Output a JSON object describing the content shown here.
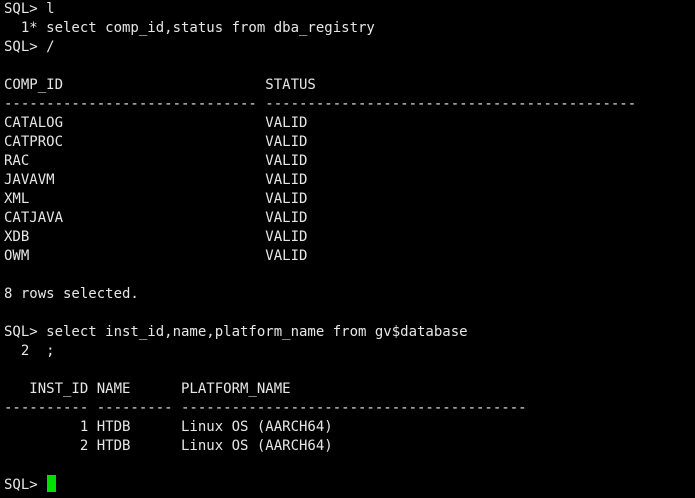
{
  "terminal": {
    "lines": [
      "SQL> l",
      "  1* select comp_id,status from dba_registry",
      "SQL> /",
      "",
      "COMP_ID                        STATUS",
      "------------------------------ --------------------------------------------",
      "CATALOG                        VALID",
      "CATPROC                        VALID",
      "RAC                            VALID",
      "JAVAVM                         VALID",
      "XML                            VALID",
      "CATJAVA                        VALID",
      "XDB                            VALID",
      "OWM                            VALID",
      "",
      "8 rows selected.",
      "",
      "SQL> select inst_id,name,platform_name from gv$database",
      "  2  ;",
      "",
      "   INST_ID NAME      PLATFORM_NAME",
      "---------- --------- -----------------------------------------",
      "         1 HTDB      Linux OS (AARCH64)",
      "         2 HTDB      Linux OS (AARCH64)",
      ""
    ],
    "prompt": "SQL> ",
    "cursor_color": "#00e000",
    "text_color": "#e6e6e6",
    "background_color": "#000000"
  }
}
